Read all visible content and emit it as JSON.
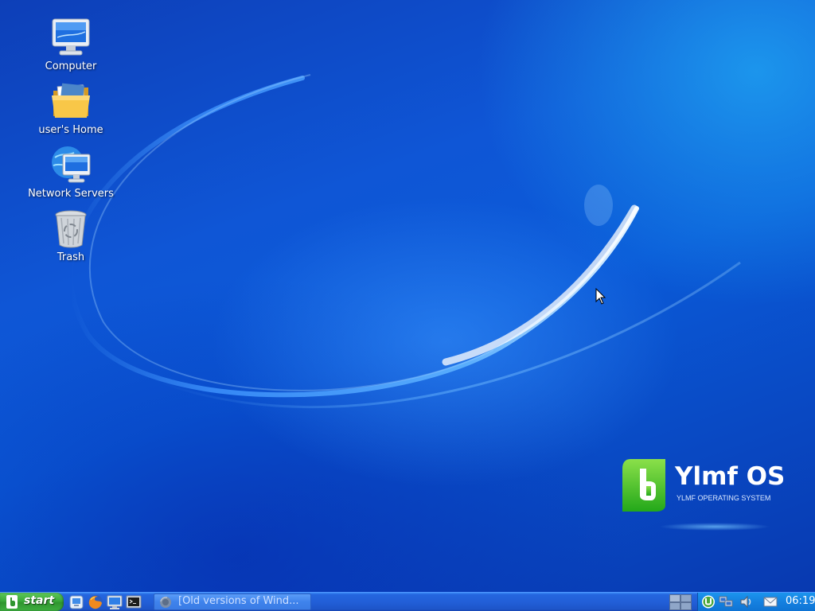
{
  "desktop": {
    "icons": [
      {
        "label": "Computer",
        "icon": "computer-icon"
      },
      {
        "label": "user's Home",
        "icon": "folder-icon"
      },
      {
        "label": "Network Servers",
        "icon": "network-icon"
      },
      {
        "label": "Trash",
        "icon": "trash-icon"
      }
    ],
    "logo": {
      "title": "Ylmf OS",
      "subtitle": "YLMF OPERATING SYSTEM"
    }
  },
  "taskbar": {
    "start_label": "start",
    "quick_launch": [
      "desktop-shortcut-icon",
      "firefox-icon",
      "monitor-icon",
      "terminal-icon"
    ],
    "tasks": [
      {
        "label": "[Old versions of Wind...",
        "icon": "firefox-icon"
      }
    ],
    "tray_icons": [
      "workspace-pager-icon",
      "utorrent-icon",
      "network-status-icon",
      "volume-icon",
      "mail-icon"
    ],
    "clock": "06:19"
  },
  "colors": {
    "desktop_blue": "#0f56d6",
    "taskbar_blue": "#225fd8",
    "start_green": "#3aa93a",
    "logo_green": "#3fbf2a"
  }
}
